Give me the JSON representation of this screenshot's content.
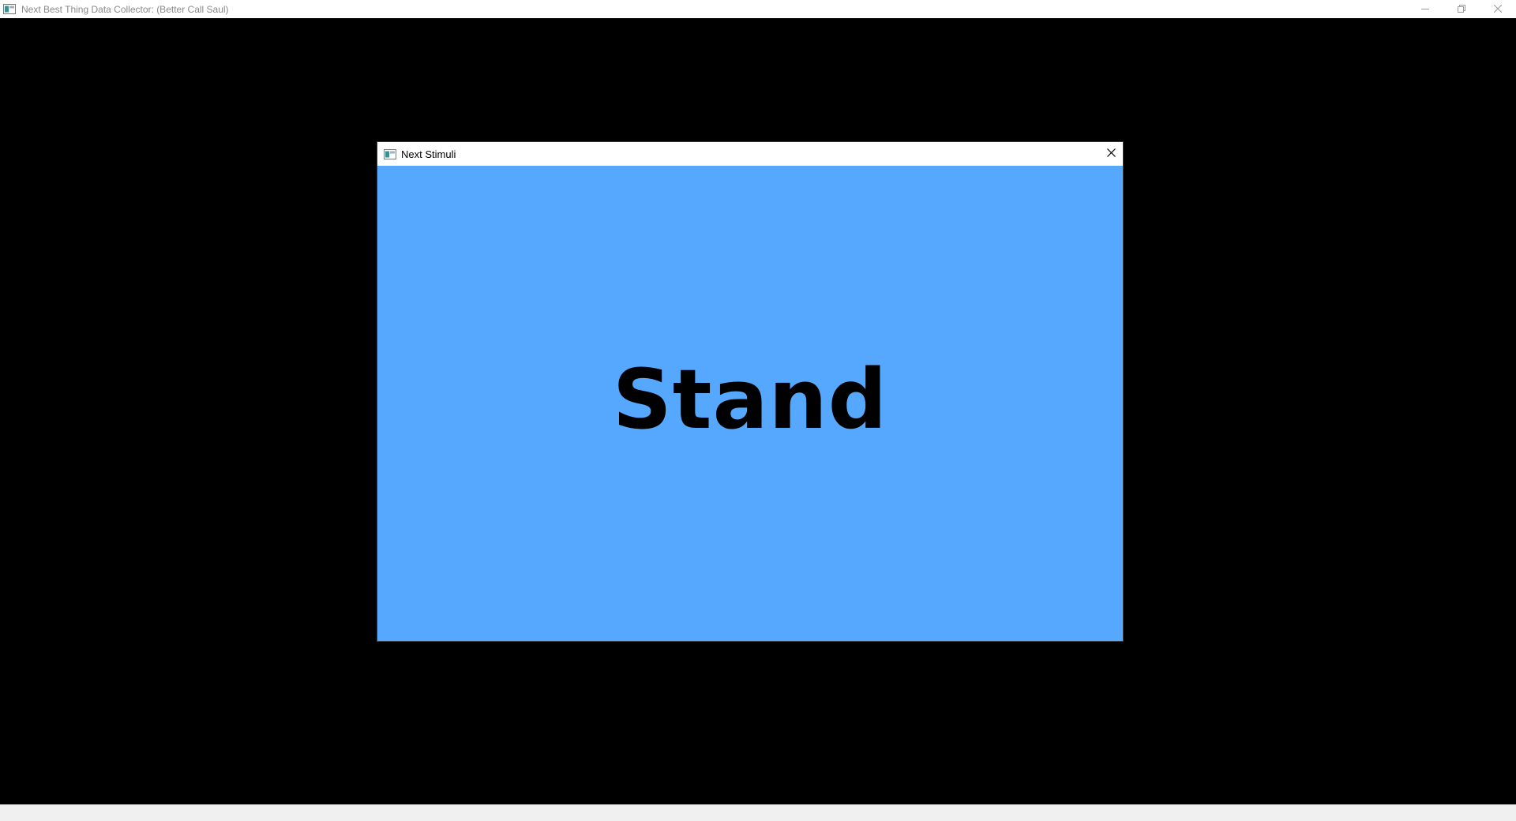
{
  "app": {
    "title": "Next Best Thing Data Collector: (Better Call Saul)",
    "icon": "app-window-icon",
    "controls": {
      "minimize": "minimize-icon",
      "restore": "restore-icon",
      "close": "close-icon"
    }
  },
  "dialog": {
    "title": "Next Stimuli",
    "icon": "app-window-icon",
    "close": "close-icon",
    "stimulus": {
      "word": "Stand",
      "background_color": "#55a8fd",
      "text_color": "#000000"
    }
  },
  "colors": {
    "client_background": "#000000",
    "titlebar_background": "#ffffff",
    "status_strip": "#f0f0f0"
  }
}
